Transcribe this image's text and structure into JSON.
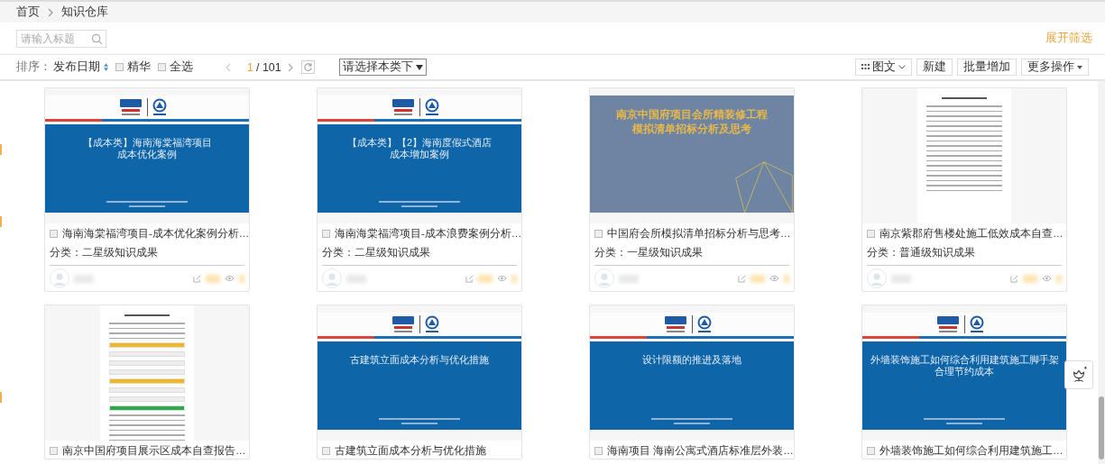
{
  "breadcrumb": [
    {
      "label": "首页"
    },
    {
      "label": "知识仓库"
    }
  ],
  "search": {
    "placeholder": "请输入标题"
  },
  "expand_filter": "展开筛选",
  "toolbar": {
    "sort_label": "排序：",
    "sort_field": "发布日期",
    "checks": [
      {
        "label": "精华",
        "checked": false
      },
      {
        "label": "全选",
        "checked": false
      }
    ],
    "page_current": "1",
    "page_total": "/ 101",
    "category_select": "请选择本类下",
    "view_button": "图文",
    "buttons": [
      {
        "label": "新建",
        "kind": "plain"
      },
      {
        "label": "批量增加",
        "kind": "plain"
      },
      {
        "label": "更多操作",
        "kind": "menu"
      }
    ]
  },
  "cards": [
    {
      "thumbnail": {
        "kind": "blue-slide",
        "title_lines": [
          "【成本类】海南海棠福湾项目",
          "成本优化案例"
        ]
      },
      "title": "海南海棠福湾项目-成本优化案例分析…",
      "checked": false,
      "category": "分类：二星级知识成果"
    },
    {
      "thumbnail": {
        "kind": "blue-slide",
        "title_lines": [
          "【成本类】【2】海南度假式酒店",
          "成本增加案例"
        ]
      },
      "title": "海南海棠福湾项目-成本浪费案例分析…",
      "checked": false,
      "category": "分类：二星级知识成果"
    },
    {
      "thumbnail": {
        "kind": "map-slide",
        "title_lines": [
          "南京中国府项目会所精装修工程",
          "模拟清单招标分析及思考"
        ]
      },
      "title": "中国府会所模拟清单招标分析与思考…",
      "checked": false,
      "category": "分类：一星级知识成果"
    },
    {
      "thumbnail": {
        "kind": "document"
      },
      "title": "南京紫郡府售楼处施工低效成本自查…",
      "checked": false,
      "category": "分类：普通级知识成果"
    },
    {
      "thumbnail": {
        "kind": "table-document"
      },
      "title": "南京中国府项目展示区成本自查报告…",
      "checked": false
    },
    {
      "thumbnail": {
        "kind": "blue-slide",
        "title_lines": [
          "古建筑立面成本分析与优化措施"
        ]
      },
      "title": "古建筑立面成本分析与优化措施",
      "checked": false
    },
    {
      "thumbnail": {
        "kind": "blue-slide",
        "title_lines": [
          "设计限额的推进及落地"
        ]
      },
      "title": "海南项目 海南公寓式酒店标准层外装…",
      "checked": false
    },
    {
      "thumbnail": {
        "kind": "blue-slide",
        "title_lines": [
          "外墙装饰施工如何综合利用建筑施工脚手架",
          "合理节约成本"
        ]
      },
      "title": "外墙装饰施工如何综合利用建筑施工…",
      "checked": false
    }
  ]
}
